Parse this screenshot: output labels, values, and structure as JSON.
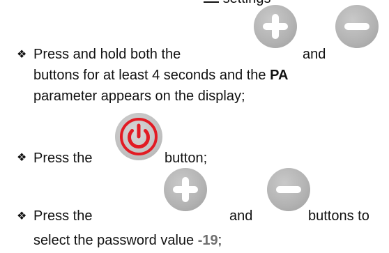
{
  "top_fragment": {
    "text": "settings"
  },
  "steps": [
    {
      "bullet": "❖",
      "line1_prefix": "Press and hold both the",
      "line1_mid": "and",
      "line2_text": "buttons for at least 4 seconds and the",
      "line2_bold": "PA",
      "line3_text": "parameter appears on the display;"
    },
    {
      "bullet": "❖",
      "line1_prefix": "Press the",
      "line1_suffix": "button;"
    },
    {
      "bullet": "❖",
      "line1_prefix": "Press the",
      "line1_mid": "and",
      "line1_suffix": "buttons to",
      "line2_prefix": "select the password value",
      "line2_value": "-19",
      "line2_suffix": ";"
    }
  ],
  "icons": {
    "plus": "plus-icon",
    "minus": "minus-icon",
    "power": "power-icon"
  },
  "colors": {
    "button_grey": "#b2b2b2",
    "power_red": "#e21b23",
    "password_value": "#6f6f6f"
  }
}
